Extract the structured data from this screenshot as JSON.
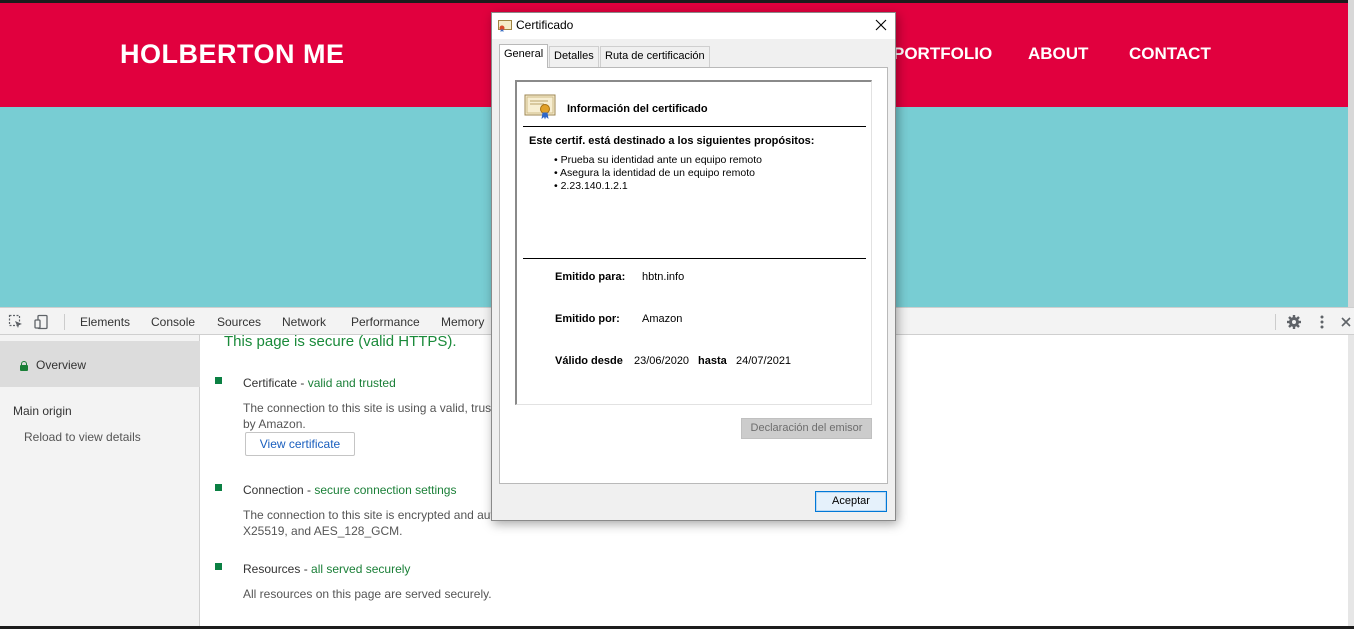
{
  "site": {
    "logo": "HOLBERTON ME",
    "nav": [
      "PORTFOLIO",
      "ABOUT",
      "CONTACT"
    ],
    "colors": {
      "header": "#e1003e",
      "hero": "#78cdd3"
    }
  },
  "devtools": {
    "toolbar_icons": [
      "select-element-icon",
      "device-toggle-icon",
      "settings-gear-icon",
      "more-vert-icon",
      "close-icon"
    ],
    "tabs": [
      "Elements",
      "Console",
      "Sources",
      "Network",
      "Performance",
      "Memory"
    ],
    "sidebar": {
      "overview": "Overview",
      "main_origin": "Main origin",
      "reload": "Reload to view details"
    },
    "security": {
      "title": "This page is secure (valid HTTPS).",
      "certificate": {
        "label": "Certificate - ",
        "status": "valid and trusted",
        "desc_line1": "The connection to this site is using a valid, trust",
        "desc_line2": "by Amazon.",
        "button": "View certificate"
      },
      "connection": {
        "label": "Connection - ",
        "status": "secure connection settings",
        "desc_line1": "The connection to this site is encrypted and aut",
        "desc_line2": "X25519, and AES_128_GCM."
      },
      "resources": {
        "label": "Resources - ",
        "status": "all served securely",
        "desc": "All resources on this page are served securely."
      }
    }
  },
  "dialog": {
    "title": "Certificado",
    "tabs": [
      "General",
      "Detalles",
      "Ruta de certificación"
    ],
    "info_title": "Información del certificado",
    "purpose_title": "Este certif. está destinado a los siguientes propósitos:",
    "purposes": [
      "• Prueba su identidad ante un equipo remoto",
      "• Asegura la identidad de un equipo remoto",
      "• 2.23.140.1.2.1"
    ],
    "issued_to_label": "Emitido para:",
    "issued_to": "hbtn.info",
    "issued_by_label": "Emitido por:",
    "issued_by": "Amazon",
    "valid_from_label": "Válido desde",
    "valid_from": "23/06/2020",
    "valid_to_label": "hasta",
    "valid_to": "24/07/2021",
    "issuer_statement_button": "Declaración del emisor",
    "accept_button": "Aceptar"
  }
}
